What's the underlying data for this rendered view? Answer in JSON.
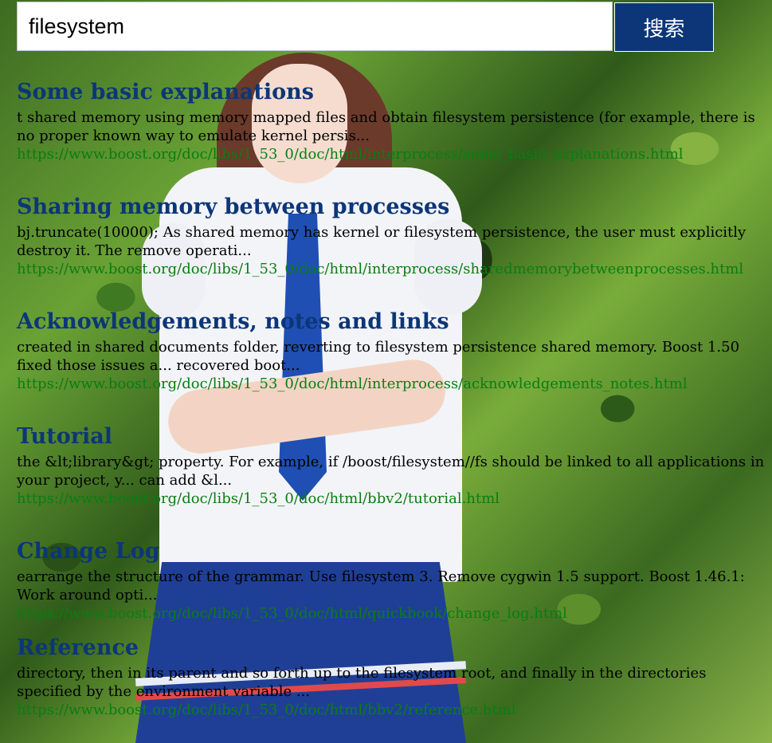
{
  "search": {
    "query": "filesystem",
    "button_label": "搜索"
  },
  "colors": {
    "title": "#0c3678",
    "url": "#0a7d12",
    "button_bg": "#0c3678"
  },
  "results": [
    {
      "title": "Some basic explanations",
      "snippet": "t shared memory using memory mapped files and obtain filesystem persistence (for example, there is no proper known way to emulate kernel persis...",
      "url": "https://www.boost.org/doc/libs/1_53_0/doc/html/interprocess/some_basic_explanations.html"
    },
    {
      "title": "Sharing memory between processes",
      "snippet": "bj.truncate(10000); As shared memory has kernel or filesystem persistence, the user must explicitly destroy it. The remove operati...",
      "url": "https://www.boost.org/doc/libs/1_53_0/doc/html/interprocess/sharedmemorybetweenprocesses.html"
    },
    {
      "title": "Acknowledgements, notes and links",
      "snippet": "created in shared documents folder, reverting to filesystem persistence shared memory. Boost 1.50 fixed those issues a... recovered boot...",
      "url": "https://www.boost.org/doc/libs/1_53_0/doc/html/interprocess/acknowledgements_notes.html"
    },
    {
      "title": "Tutorial",
      "snippet": "the &lt;library&gt; property. For example, if /boost/filesystem//fs should be linked to all applications in your project, y... can add &l...",
      "url": "https://www.boost.org/doc/libs/1_53_0/doc/html/bbv2/tutorial.html"
    },
    {
      "title": "Change Log",
      "snippet": "earrange the structure of the grammar. Use filesystem 3. Remove cygwin 1.5 support. Boost 1.46.1: Work around opti...",
      "url": "https://www.boost.org/doc/libs/1_53_0/doc/html/quickbook/change_log.html"
    },
    {
      "title": "Reference",
      "snippet": "directory, then in its parent and so forth up to the filesystem root, and finally in the directories specified by the environment variable ...",
      "url": "https://www.boost.org/doc/libs/1_53_0/doc/html/bbv2/reference.html"
    }
  ]
}
